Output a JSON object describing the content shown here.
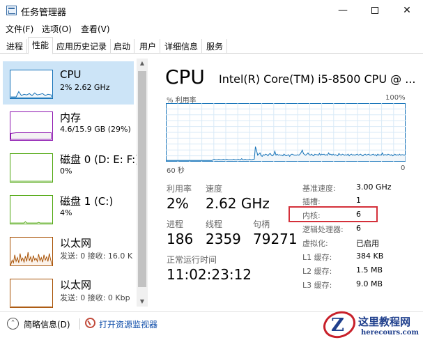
{
  "window": {
    "title": "任务管理器",
    "minimize": "—",
    "close": "✕"
  },
  "menu": [
    "文件(F)",
    "选项(O)",
    "查看(V)"
  ],
  "tabs": [
    "进程",
    "性能",
    "应用历史记录",
    "启动",
    "用户",
    "详细信息",
    "服务"
  ],
  "active_tab": "性能",
  "sidebar": [
    {
      "title": "CPU",
      "subtitle": "2% 2.62 GHz",
      "selected": true,
      "color": "#1170b7",
      "usage": 0.02
    },
    {
      "title": "内存",
      "subtitle": "4.6/15.9 GB (29%)",
      "selected": false,
      "color": "#8b12ae",
      "usage": 0.29
    },
    {
      "title": "磁盘 0 (D: E: F:)",
      "subtitle": "0%",
      "selected": false,
      "color": "#4da60c",
      "usage": 0.0
    },
    {
      "title": "磁盘 1 (C:)",
      "subtitle": "4%",
      "selected": false,
      "color": "#4da60c",
      "usage": 0.04
    },
    {
      "title": "以太网",
      "subtitle": "发送: 0 接收: 16.0 K",
      "selected": false,
      "color": "#a74f01"
    },
    {
      "title": "以太网",
      "subtitle": "发送: 0 接收: 0 Kbp",
      "selected": false,
      "color": "#a74f01"
    }
  ],
  "main": {
    "title": "CPU",
    "model": "Intel(R) Core(TM) i5-8500 CPU @ ...",
    "graph_label_left": "% 利用率",
    "graph_label_right": "100%",
    "graph_time_left": "60 秒",
    "graph_time_right": "0",
    "stats": {
      "util_label": "利用率",
      "util_value": "2%",
      "speed_label": "速度",
      "speed_value": "2.62 GHz",
      "proc_label": "进程",
      "proc_value": "186",
      "thread_label": "线程",
      "thread_value": "2359",
      "handle_label": "句柄",
      "handle_value": "79271",
      "uptime_label": "正常运行时间",
      "uptime_value": "11:02:23:12"
    },
    "info": [
      {
        "label": "基准速度:",
        "value": "3.00 GHz"
      },
      {
        "label": "插槽:",
        "value": "1"
      },
      {
        "label": "内核:",
        "value": "6"
      },
      {
        "label": "逻辑处理器:",
        "value": "6"
      },
      {
        "label": "虚拟化:",
        "value": "已启用"
      },
      {
        "label": "L1 缓存:",
        "value": "384 KB"
      },
      {
        "label": "L2 缓存:",
        "value": "1.5 MB"
      },
      {
        "label": "L3 缓存:",
        "value": "9.0 MB"
      }
    ],
    "cpu_history": [
      1,
      1,
      1,
      1,
      1,
      1,
      1,
      1,
      1,
      1,
      1,
      1,
      1,
      1,
      1,
      1,
      1,
      1,
      1,
      1,
      1,
      1,
      1,
      1,
      1,
      1,
      1,
      1,
      1,
      1,
      1,
      1,
      1,
      1,
      1,
      1,
      1,
      1,
      1,
      1,
      1,
      2,
      3,
      2,
      2,
      2,
      3,
      2,
      2,
      2,
      3,
      2,
      2,
      3,
      2,
      2,
      2,
      2,
      2,
      3,
      2,
      2,
      2,
      3,
      2,
      2,
      4,
      2,
      2,
      3,
      2,
      2,
      2,
      3,
      2,
      2,
      3,
      3,
      25,
      18,
      10,
      12,
      14,
      9,
      8,
      11,
      10,
      12,
      11,
      9,
      12,
      13,
      10,
      9,
      11,
      17,
      10,
      12,
      10,
      11,
      10,
      10,
      9,
      12,
      10,
      9,
      10,
      11,
      8,
      11,
      12,
      11,
      10,
      10,
      10,
      11,
      10,
      12,
      15,
      19,
      13,
      11,
      10,
      12,
      14,
      11,
      10,
      12,
      10,
      9,
      12,
      11,
      11,
      10,
      13,
      10,
      12,
      11,
      12,
      10,
      11,
      10,
      14,
      11,
      12,
      10,
      12,
      10,
      11,
      10,
      9,
      13,
      11,
      10,
      12,
      11,
      10,
      11,
      10,
      12,
      9,
      11,
      12,
      10,
      11,
      10,
      11,
      12,
      10,
      11,
      12,
      10,
      9,
      11,
      12,
      10,
      11,
      12,
      10,
      10,
      11,
      12,
      10,
      11,
      9,
      12,
      10,
      11,
      10,
      14,
      10,
      11,
      11,
      10,
      12,
      11,
      10,
      11,
      9,
      10,
      12,
      10,
      11,
      10,
      12,
      10,
      11,
      11,
      10,
      11
    ]
  },
  "bottom": {
    "brief_label": "简略信息(D)",
    "monitor_link": "打开资源监视器"
  },
  "watermark": {
    "title": "这里教程网",
    "url": "herecours.com"
  },
  "colors": {
    "cpu_line": "#1170b7",
    "cpu_fill": "#f1f6fa",
    "grid": "#d9eaf7",
    "highlight": "#d4303a"
  }
}
